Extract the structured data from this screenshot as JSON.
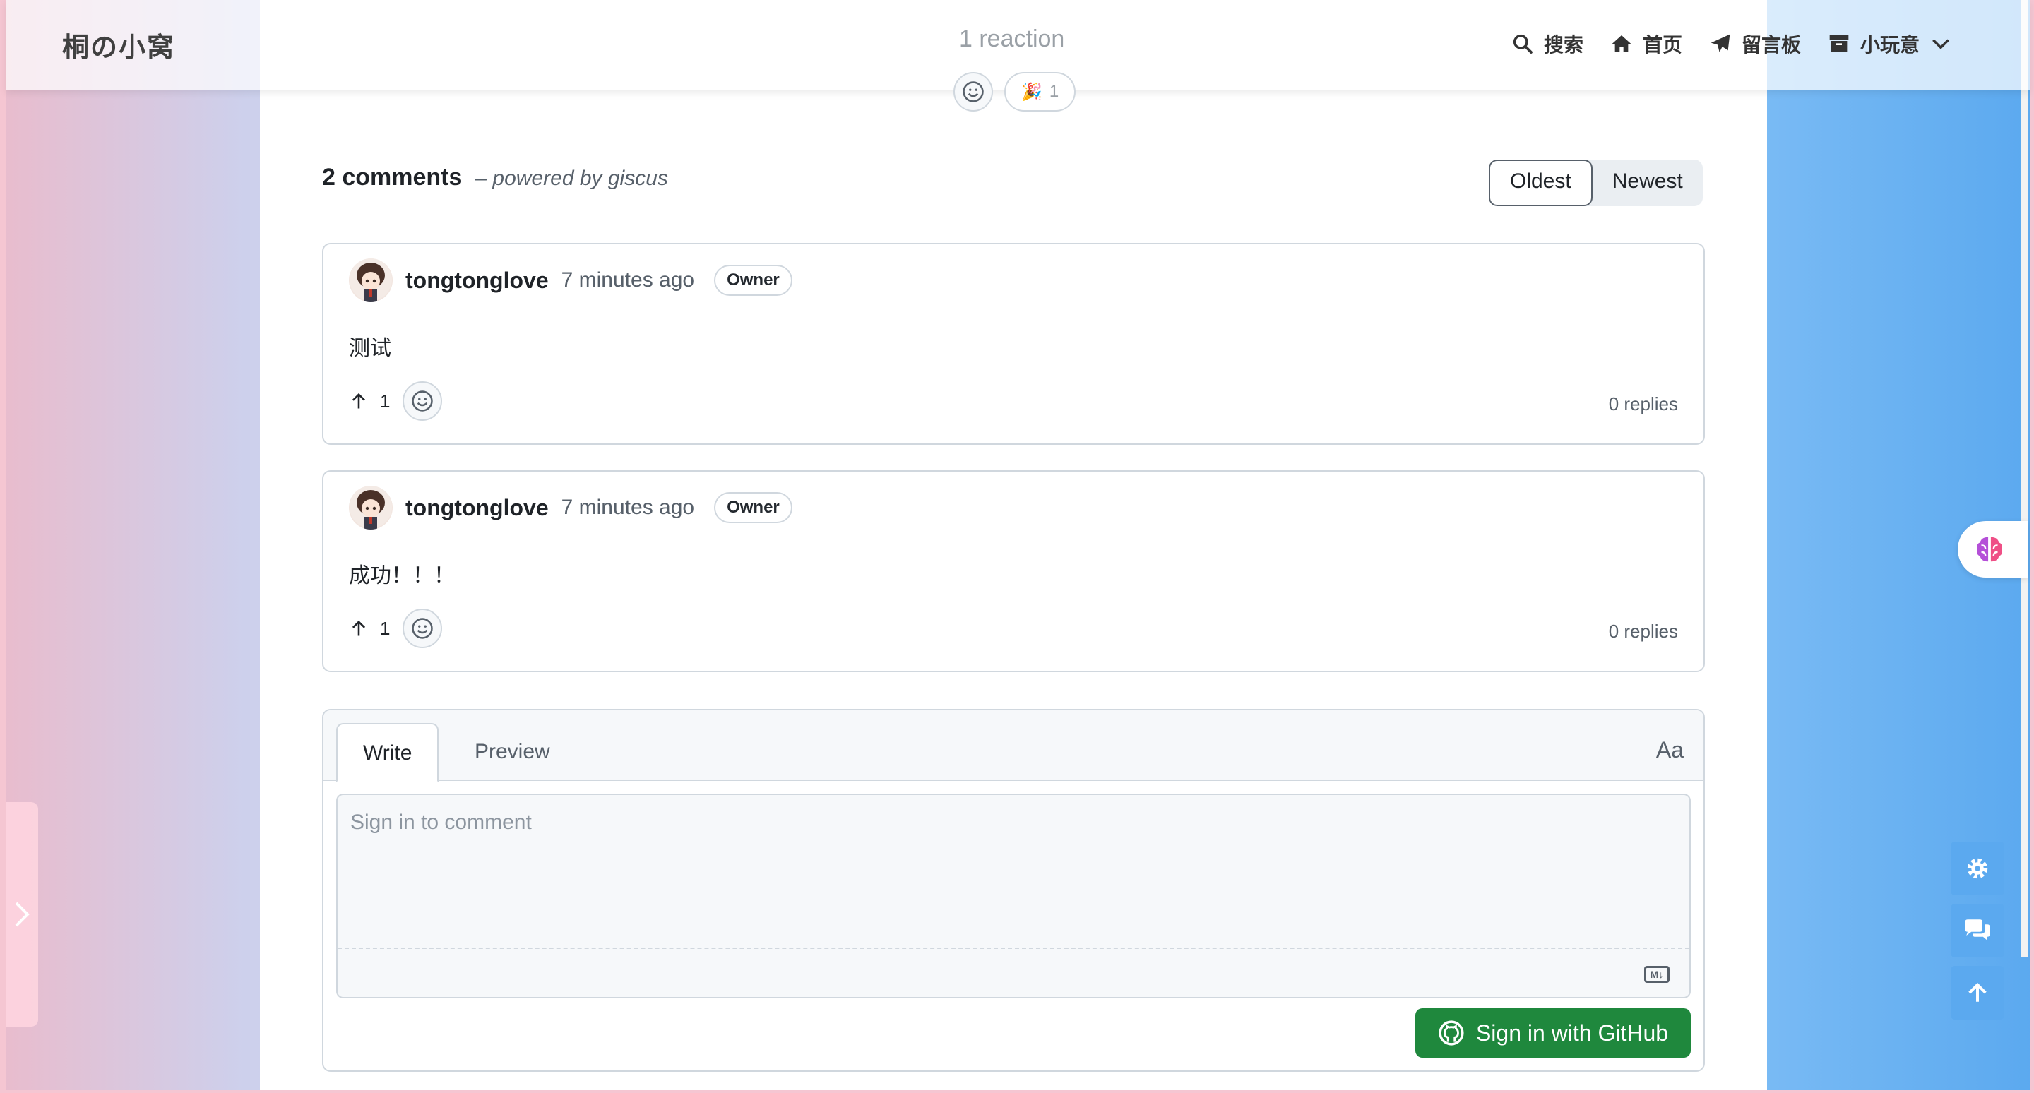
{
  "header": {
    "brand": "桐の小窝",
    "reaction_count": "1 reaction",
    "nav": [
      {
        "label": "搜索",
        "icon": "search-icon"
      },
      {
        "label": "首页",
        "icon": "home-icon"
      },
      {
        "label": "留言板",
        "icon": "paper-plane-icon"
      },
      {
        "label": "小玩意",
        "icon": "archive-icon"
      }
    ]
  },
  "reactions": {
    "pill_count": "1"
  },
  "comments_section": {
    "title": "2 comments",
    "powered": "– powered by giscus",
    "sort": {
      "oldest": "Oldest",
      "newest": "Newest"
    }
  },
  "comments": [
    {
      "author": "tongtonglove",
      "time": "7 minutes ago",
      "badge": "Owner",
      "body": "测试",
      "upvotes": "1",
      "replies": "0 replies"
    },
    {
      "author": "tongtonglove",
      "time": "7 minutes ago",
      "badge": "Owner",
      "body": "成功！！！",
      "upvotes": "1",
      "replies": "0 replies"
    }
  ],
  "editor": {
    "write_tab": "Write",
    "preview_tab": "Preview",
    "aa": "Aa",
    "placeholder": "Sign in to comment",
    "markdown_badge": "M↓",
    "signin_button": "Sign in with GitHub"
  },
  "colors": {
    "accent": "#1f883d",
    "float_button": "#5ba9ef"
  }
}
